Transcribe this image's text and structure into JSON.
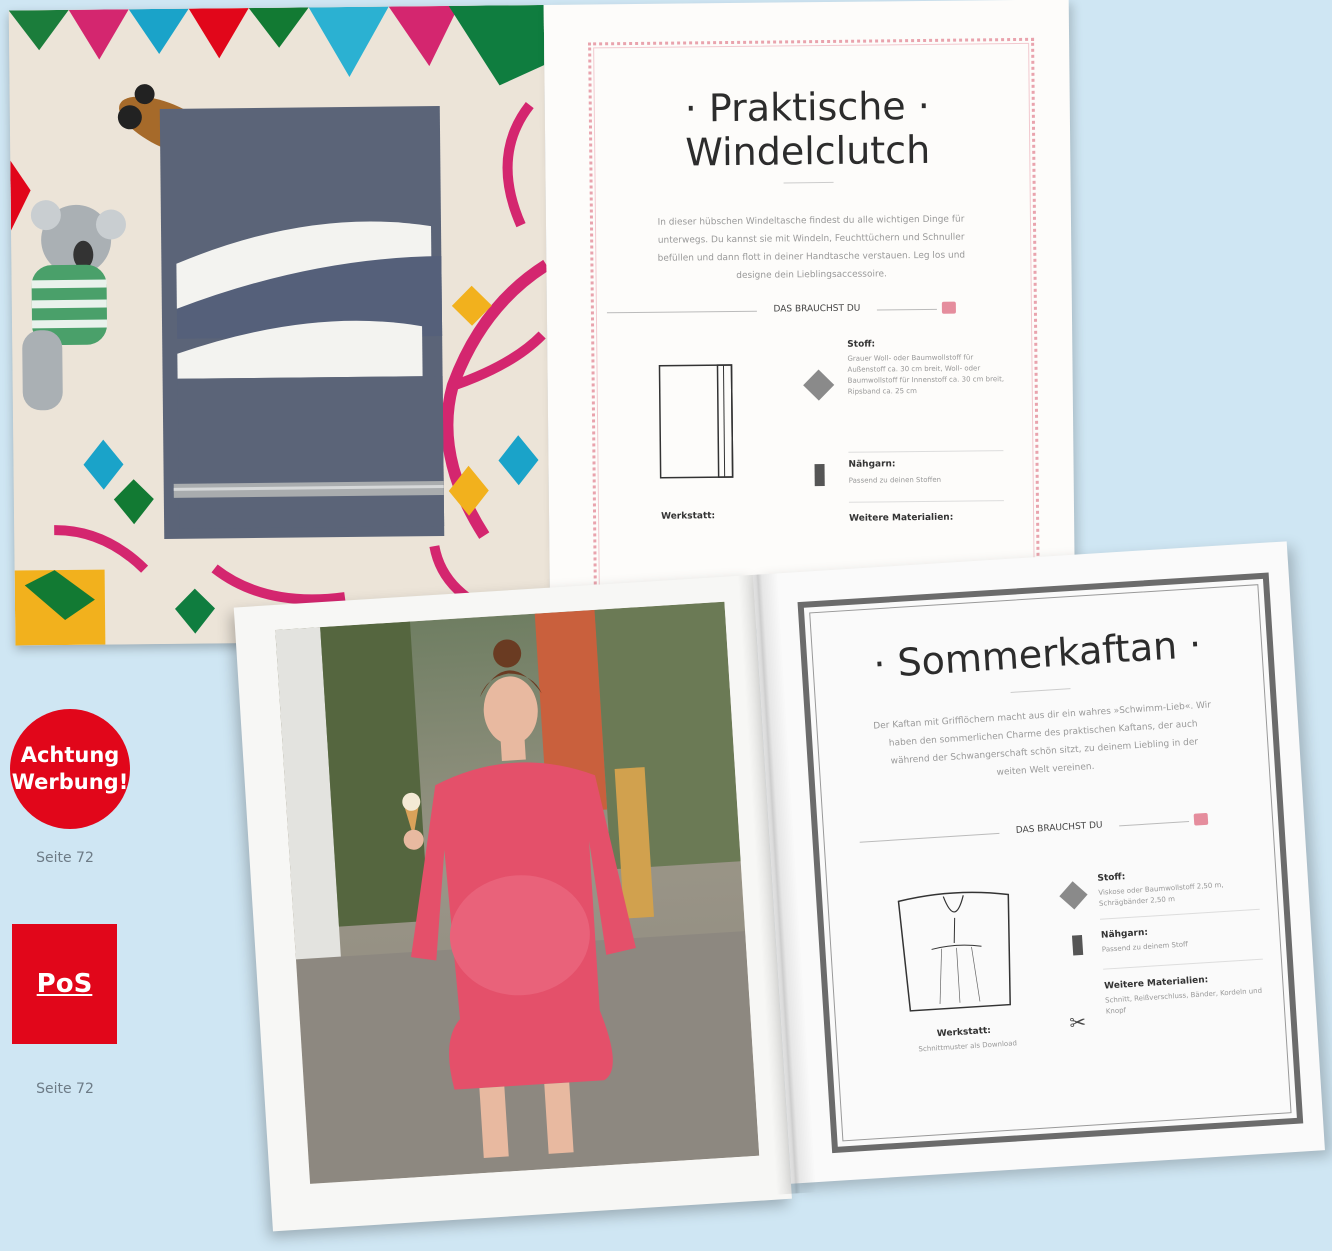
{
  "book1": {
    "title_line1": "· Praktische ·",
    "title_line2": "Windelclutch",
    "intro": "In dieser hübschen Windeltasche findest du alle wichtigen Dinge für unterwegs. Du kannst sie mit Windeln, Feuchttüchern und Schnuller befüllen und dann flott in deiner Handtasche verstauen. Leg los und designe dein Lieblingsaccessoire.",
    "section_heading": "DAS BRAUCHST DU",
    "materials": [
      {
        "title": "Stoff:",
        "text": "Grauer Woll- oder Baumwollstoff für Außenstoff ca. 30 cm breit, Woll- oder Baumwollstoff für Innenstoff ca. 30 cm breit, Ripsband ca. 25 cm"
      },
      {
        "title": "Nähgarn:",
        "text": "Passend zu deinen Stoffen"
      },
      {
        "title": "Weitere Materialien:",
        "text": ""
      }
    ],
    "pattern_label": "Werkstatt:"
  },
  "book2": {
    "title": "· Sommerkaftan ·",
    "intro": "Der Kaftan mit Grifflöchern macht aus dir ein wahres »Schwimm-Lieb«. Wir haben den sommerlichen Charme des praktischen Kaftans, der auch während der Schwangerschaft schön sitzt, zu deinem Liebling in der weiten Welt vereinen.",
    "section_heading": "DAS BRAUCHST DU",
    "materials": [
      {
        "title": "Stoff:",
        "text": "Viskose oder Baumwollstoff 2,50 m, Schrägbänder 2,50 m"
      },
      {
        "title": "Nähgarn:",
        "text": "Passend zu deinem Stoff"
      },
      {
        "title": "Weitere Materialien:",
        "text": "Schnitt, Reißverschluss, Bänder, Kordeln und Knopf"
      }
    ],
    "pattern_label": "Werkstatt:",
    "pattern_sub": "Schnittmuster als Download"
  },
  "badges": {
    "ad_line1": "Achtung",
    "ad_line2": "Werbung!",
    "ad_page": "Seite 72",
    "pos_label": "PoS",
    "pos_page": "Seite 72"
  },
  "colors": {
    "background": "#cfe6f3",
    "brand_red": "#e1061a",
    "kaftan_pink": "#e4506a",
    "clutch_grey": "#5b6478"
  }
}
